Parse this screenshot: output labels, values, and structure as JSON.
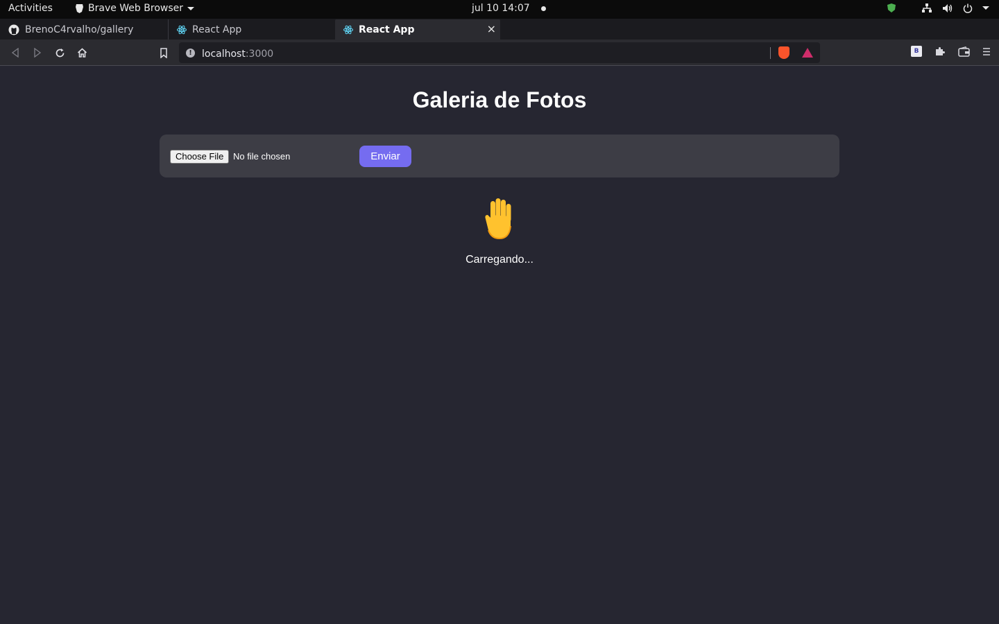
{
  "system_bar": {
    "activities": "Activities",
    "app_name": "Brave Web Browser",
    "clock": "jul 10  14:07"
  },
  "tabs": [
    {
      "label": "BrenoC4rvalho/gallery",
      "icon": "github-icon",
      "active": false
    },
    {
      "label": "React App",
      "icon": "react-icon",
      "active": false
    },
    {
      "label": "React App",
      "icon": "react-icon",
      "active": true
    }
  ],
  "tab_close": "×",
  "new_tab": "+",
  "address_bar": {
    "host": "localhost",
    "port": ":3000",
    "info_glyph": "!"
  },
  "extension_badge": "B",
  "page": {
    "title": "Galeria de Fotos",
    "file_button": "Choose File",
    "file_status": "No file chosen",
    "submit_label": "Enviar",
    "loading_text": "Carregando..."
  },
  "colors": {
    "page_bg": "#262631",
    "panel_bg": "#3d3d45",
    "accent": "#756cf0"
  }
}
